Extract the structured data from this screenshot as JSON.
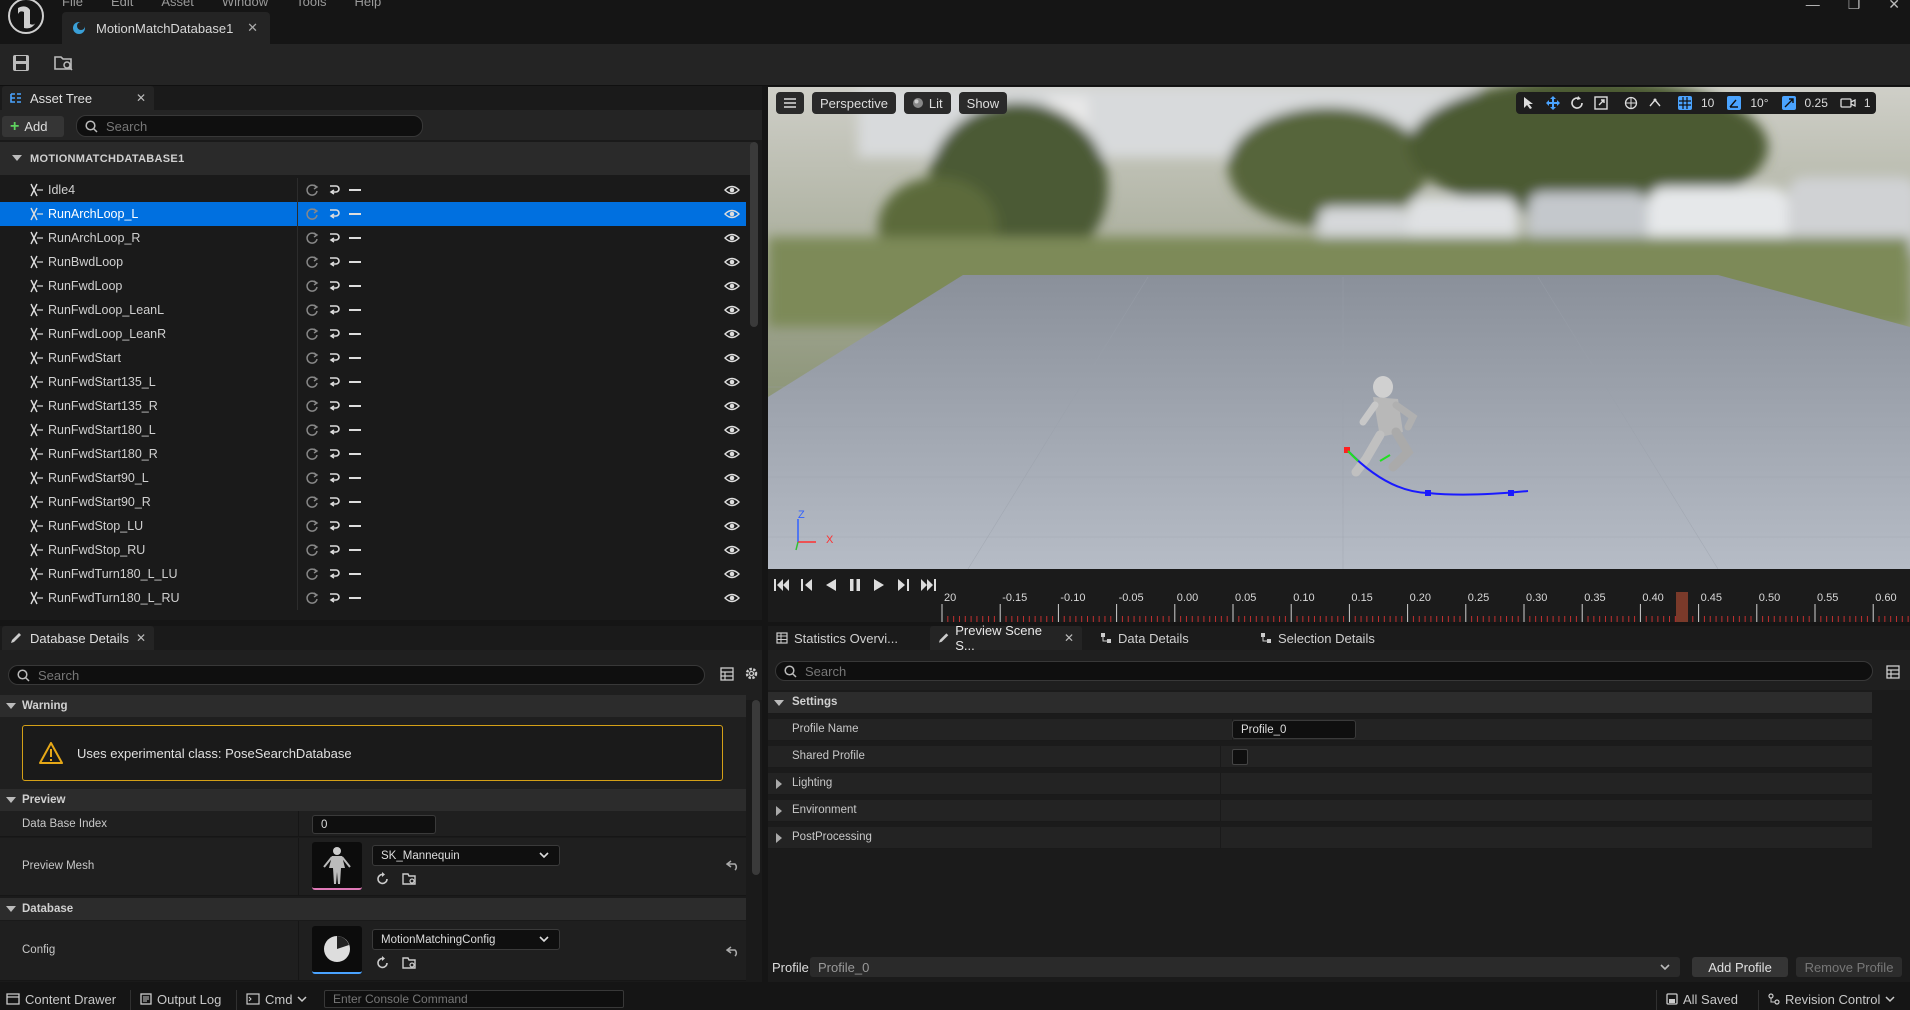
{
  "app": {
    "menu": [
      "File",
      "Edit",
      "Asset",
      "Window",
      "Tools",
      "Help"
    ],
    "document_tab": "MotionMatchDatabase1",
    "window_controls": [
      "—",
      "❐",
      "✕"
    ]
  },
  "asset_tree": {
    "tab_label": "Asset Tree",
    "add_label": "Add",
    "search_placeholder": "Search",
    "root_label": "MOTIONMATCHDATABASE1",
    "items": [
      {
        "label": "Idle4",
        "selected": false
      },
      {
        "label": "RunArchLoop_L",
        "selected": true
      },
      {
        "label": "RunArchLoop_R",
        "selected": false
      },
      {
        "label": "RunBwdLoop",
        "selected": false
      },
      {
        "label": "RunFwdLoop",
        "selected": false
      },
      {
        "label": "RunFwdLoop_LeanL",
        "selected": false
      },
      {
        "label": "RunFwdLoop_LeanR",
        "selected": false
      },
      {
        "label": "RunFwdStart",
        "selected": false
      },
      {
        "label": "RunFwdStart135_L",
        "selected": false
      },
      {
        "label": "RunFwdStart135_R",
        "selected": false
      },
      {
        "label": "RunFwdStart180_L",
        "selected": false
      },
      {
        "label": "RunFwdStart180_R",
        "selected": false
      },
      {
        "label": "RunFwdStart90_L",
        "selected": false
      },
      {
        "label": "RunFwdStart90_R",
        "selected": false
      },
      {
        "label": "RunFwdStop_LU",
        "selected": false
      },
      {
        "label": "RunFwdStop_RU",
        "selected": false
      },
      {
        "label": "RunFwdTurn180_L_LU",
        "selected": false
      },
      {
        "label": "RunFwdTurn180_L_RU",
        "selected": false
      }
    ]
  },
  "viewport": {
    "perspective_label": "Perspective",
    "lit_label": "Lit",
    "show_label": "Show",
    "grid_snap": "10",
    "rotation_snap": "10°",
    "scale_snap": "0.25",
    "camera_speed": "1",
    "axis_labels": {
      "z": "Z",
      "x": "X"
    }
  },
  "timeline": {
    "ticks": [
      "20",
      "-0.15",
      "-0.10",
      "-0.05",
      "0.00",
      "0.05",
      "0.10",
      "0.15",
      "0.20",
      "0.25",
      "0.30",
      "0.35",
      "0.40",
      "0.45",
      "0.50",
      "0.55",
      "0.60"
    ]
  },
  "database_details": {
    "tab_label": "Database Details",
    "search_placeholder": "Search",
    "warning_section": "Warning",
    "warning_text": "Uses experimental class: PoseSearchDatabase",
    "preview_section": "Preview",
    "data_base_index_label": "Data Base Index",
    "data_base_index_value": "0",
    "preview_mesh_label": "Preview Mesh",
    "preview_mesh_value": "SK_Mannequin",
    "database_section": "Database",
    "config_label": "Config",
    "config_value": "MotionMatchingConfig"
  },
  "right_panel": {
    "tabs": [
      "Statistics Overvi...",
      "Preview Scene S...",
      "Data Details",
      "Selection Details"
    ],
    "search_placeholder": "Search",
    "settings_section": "Settings",
    "profile_name_label": "Profile Name",
    "profile_name_value": "Profile_0",
    "shared_profile_label": "Shared Profile",
    "lighting_label": "Lighting",
    "environment_label": "Environment",
    "postprocessing_label": "PostProcessing",
    "profile_label": "Profile",
    "profile_value": "Profile_0",
    "add_profile": "Add Profile",
    "remove_profile": "Remove Profile"
  },
  "status_bar": {
    "content_drawer": "Content Drawer",
    "output_log": "Output Log",
    "cmd": "Cmd",
    "console_placeholder": "Enter Console Command",
    "all_saved": "All Saved",
    "revision_control": "Revision Control"
  },
  "colors": {
    "selection": "#0070e0",
    "warning_border": "#d4a017",
    "trajectory": "#1a1aff"
  }
}
